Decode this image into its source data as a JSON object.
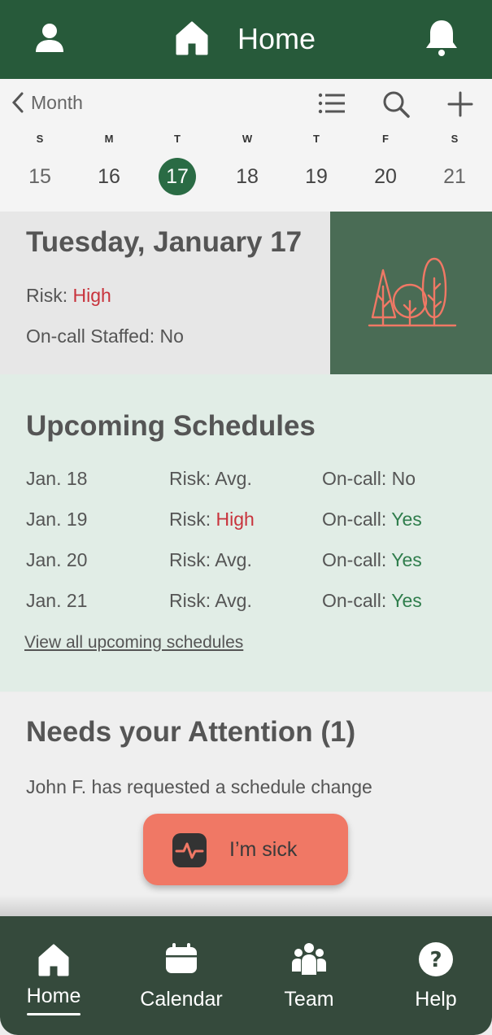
{
  "header": {
    "title": "Home"
  },
  "week": {
    "back_label": "Month",
    "days": [
      {
        "dow": "S",
        "num": "15"
      },
      {
        "dow": "M",
        "num": "16"
      },
      {
        "dow": "T",
        "num": "17"
      },
      {
        "dow": "W",
        "num": "18"
      },
      {
        "dow": "T",
        "num": "19"
      },
      {
        "dow": "F",
        "num": "20"
      },
      {
        "dow": "S",
        "num": "21"
      }
    ],
    "selected": "17"
  },
  "today": {
    "title": "Tuesday, January 17",
    "risk_label": "Risk: ",
    "risk_value": "High",
    "oncall_text": "On-call Staffed: No"
  },
  "upcoming": {
    "heading": "Upcoming Schedules",
    "rows": [
      {
        "date": "Jan. 18",
        "risk_label": "Risk: ",
        "risk": "Avg.",
        "oncall_label": "On-call: ",
        "oncall": "No"
      },
      {
        "date": "Jan. 19",
        "risk_label": "Risk: ",
        "risk": "High",
        "oncall_label": "On-call: ",
        "oncall": "Yes"
      },
      {
        "date": "Jan. 20",
        "risk_label": "Risk: ",
        "risk": "Avg.",
        "oncall_label": "On-call: ",
        "oncall": "Yes"
      },
      {
        "date": "Jan. 21",
        "risk_label": "Risk: ",
        "risk": "Avg.",
        "oncall_label": "On-call: ",
        "oncall": "Yes"
      }
    ],
    "view_all": "View all upcoming schedules"
  },
  "attention": {
    "heading": "Needs your Attention (1)",
    "message": "John F. has requested a schedule change"
  },
  "sick_button": {
    "label": "I’m sick"
  },
  "nav": {
    "items": [
      {
        "label": "Home",
        "icon": "home-icon"
      },
      {
        "label": "Calendar",
        "icon": "calendar-icon"
      },
      {
        "label": "Team",
        "icon": "team-icon"
      },
      {
        "label": "Help",
        "icon": "help-icon"
      }
    ],
    "active": "Home"
  },
  "colors": {
    "brand_green": "#275a3a",
    "nav_dark": "#354a3c",
    "alert_red": "#c8333c",
    "ok_green": "#2f7d4c",
    "sick_coral": "#f07865"
  }
}
